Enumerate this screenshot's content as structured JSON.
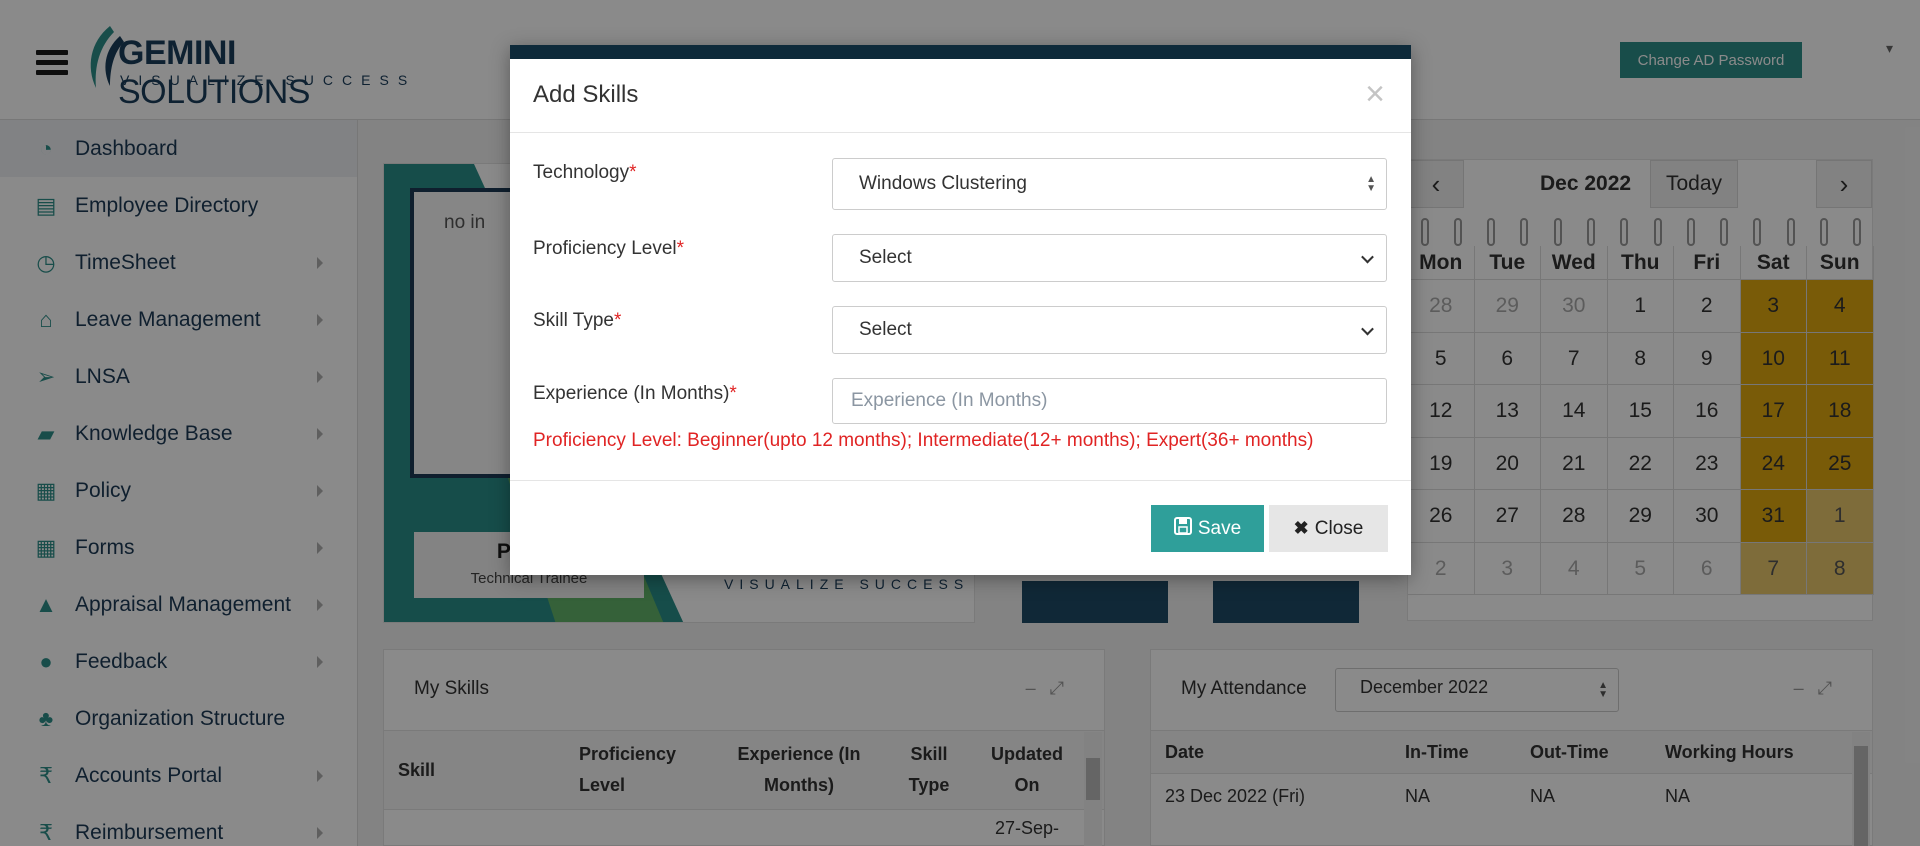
{
  "header": {
    "logo_main_bold": "GEMINI",
    "logo_main_light": "SOLUTIONS",
    "logo_tagline": "VISUALIZE SUCCESS",
    "change_ad_password": "Change AD Password",
    "user_menu_caret": "▾"
  },
  "sidebar": {
    "items": [
      {
        "label": "Dashboard",
        "icon": "dashboard-icon",
        "glyph": "◔",
        "has_submenu": false
      },
      {
        "label": "Employee Directory",
        "icon": "contact-book-icon",
        "glyph": "▤",
        "has_submenu": false
      },
      {
        "label": "TimeSheet",
        "icon": "clock-icon",
        "glyph": "◷",
        "has_submenu": true
      },
      {
        "label": "Leave Management",
        "icon": "home-icon",
        "glyph": "⌂",
        "has_submenu": true
      },
      {
        "label": "LNSA",
        "icon": "paper-plane-icon",
        "glyph": "➢",
        "has_submenu": true
      },
      {
        "label": "Knowledge Base",
        "icon": "folder-open-icon",
        "glyph": "▰",
        "has_submenu": true
      },
      {
        "label": "Policy",
        "icon": "document-icon",
        "glyph": "▦",
        "has_submenu": true
      },
      {
        "label": "Forms",
        "icon": "file-text-icon",
        "glyph": "▦",
        "has_submenu": true
      },
      {
        "label": "Appraisal Management",
        "icon": "graduation-cap-icon",
        "glyph": "▲",
        "has_submenu": true
      },
      {
        "label": "Feedback",
        "icon": "comments-icon",
        "glyph": "●",
        "has_submenu": true
      },
      {
        "label": "Organization Structure",
        "icon": "sitemap-icon",
        "glyph": "♣",
        "has_submenu": false
      },
      {
        "label": "Accounts Portal",
        "icon": "rupee-icon",
        "glyph": "₹",
        "has_submenu": true
      },
      {
        "label": "Reimbursement",
        "icon": "rupee-icon",
        "glyph": "₹",
        "has_submenu": true
      }
    ]
  },
  "profile": {
    "photo_alt": "no in",
    "name": "Priyan",
    "role": "Technical Trainee",
    "card_tagline": "VISUALIZE SUCCESS"
  },
  "calendar": {
    "title": "Dec 2022",
    "today_label": "Today",
    "prev_label": "‹",
    "next_label": "›",
    "weekdays": [
      "Mon",
      "Tue",
      "Wed",
      "Thu",
      "Fri",
      "Sat",
      "Sun"
    ],
    "weeks": [
      [
        "28",
        "29",
        "30",
        "1",
        "2",
        "3",
        "4"
      ],
      [
        "5",
        "6",
        "7",
        "8",
        "9",
        "10",
        "11"
      ],
      [
        "12",
        "13",
        "14",
        "15",
        "16",
        "17",
        "18"
      ],
      [
        "19",
        "20",
        "21",
        "22",
        "23",
        "24",
        "25"
      ],
      [
        "26",
        "27",
        "28",
        "29",
        "30",
        "31",
        "1"
      ],
      [
        "2",
        "3",
        "4",
        "5",
        "6",
        "7",
        "8"
      ]
    ],
    "weekend_color": "#e0a90f"
  },
  "skills_panel": {
    "title": "My Skills",
    "columns": [
      "Skill",
      "Proficiency Level",
      "Experience (In Months)",
      "Skill Type",
      "Updated On"
    ],
    "partial_cell": "27-Sep-"
  },
  "attendance_panel": {
    "title": "My Attendance",
    "month_select": "December 2022",
    "columns": [
      "Date",
      "In-Time",
      "Out-Time",
      "Working Hours"
    ],
    "rows": [
      {
        "date": "23 Dec 2022 (Fri)",
        "in": "NA",
        "out": "NA",
        "hours": "NA"
      }
    ]
  },
  "modal": {
    "title": "Add Skills",
    "close_x": "×",
    "fields": {
      "technology": {
        "label": "Technology",
        "value": "Windows Clustering"
      },
      "proficiency": {
        "label": "Proficiency Level",
        "value": "Select"
      },
      "skill_type": {
        "label": "Skill Type",
        "value": "Select"
      },
      "experience": {
        "label": "Experience (In Months)",
        "placeholder": "Experience (In Months)"
      }
    },
    "required_marker": "*",
    "note": "Proficiency Level: Beginner(upto 12 months); Intermediate(12+ months); Expert(36+ months)",
    "save_label": "Save",
    "close_label": "Close"
  },
  "colors": {
    "accent": "#2e8f8a",
    "navy": "#1d3a56",
    "required": "#e02424",
    "modal_bar": "#0e2a3a"
  }
}
